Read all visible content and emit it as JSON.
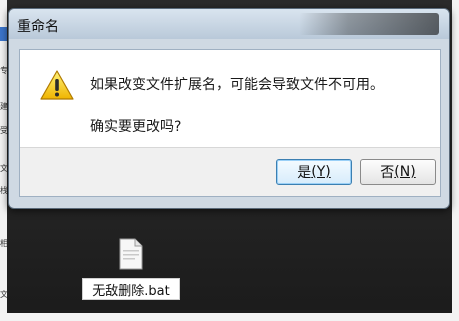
{
  "dialog": {
    "title": "重命名",
    "message_line1": "如果改变文件扩展名，可能会导致文件不可用。",
    "message_line2": "确实要更改吗?",
    "buttons": {
      "yes": {
        "text": "是",
        "access": "(Y)"
      },
      "no": {
        "text": "否",
        "access": "(N)"
      }
    },
    "icon": "warning-triangle-icon"
  },
  "desktop": {
    "file": {
      "name": "无敌删除.bat",
      "icon": "file-icon"
    }
  },
  "background_fragments": {
    "left": [
      "专",
      "建",
      "受",
      "文",
      "栈",
      "相",
      "文"
    ]
  },
  "colors": {
    "dialog_frame": "#cfd9e3",
    "titlebar_start": "#d9e4ef",
    "titlebar_end": "#b9c9d9",
    "warning_yellow": "#f1c40f",
    "default_button_border": "#3c7fb1",
    "desktop_bg": "#242424",
    "left_blue_tab": "#3b74c9"
  }
}
